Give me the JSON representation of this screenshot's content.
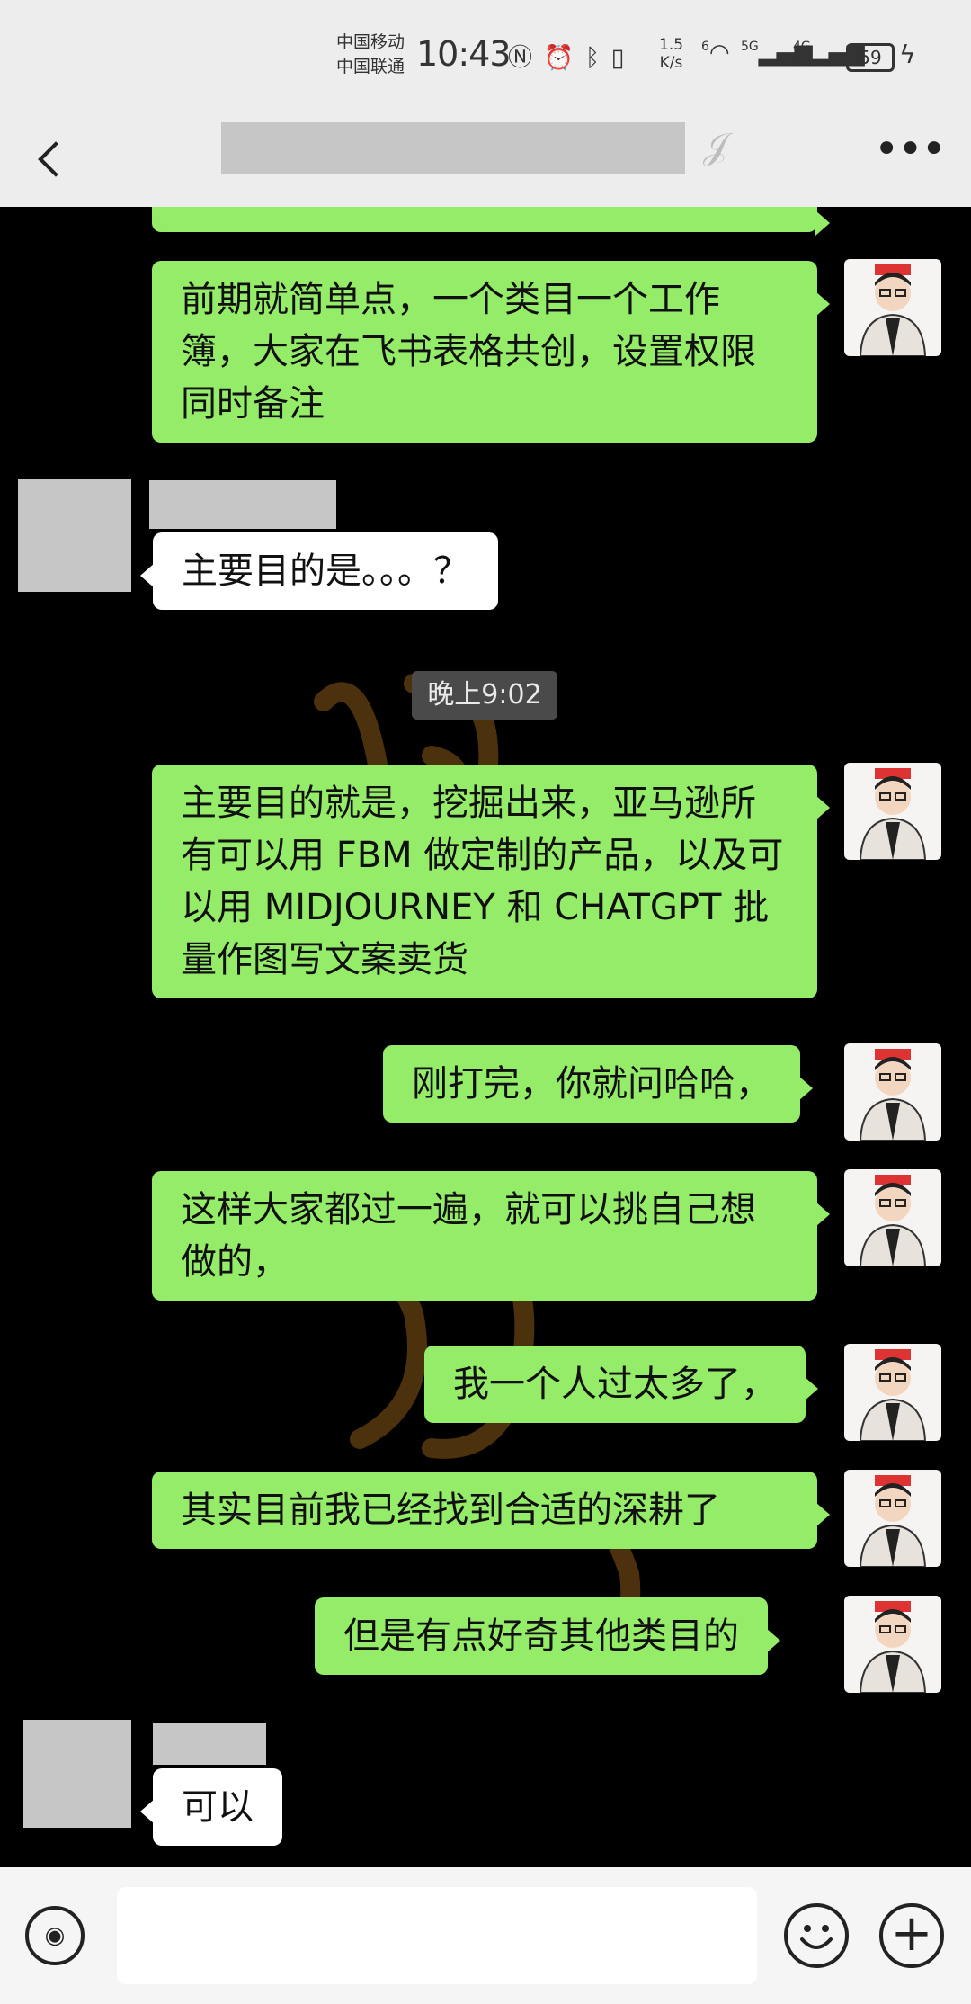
{
  "status": {
    "carrier1": "中国移动",
    "carrier2": "中国联通",
    "time": "10:43",
    "speed_value": "1.5",
    "speed_unit": "K/s",
    "sig_6": "6",
    "sig_5g": "5G",
    "sig_4g": "4G",
    "battery": "59"
  },
  "nav": {
    "more": "•••"
  },
  "messages": [
    {
      "text": "前期就简单点，一个类目一个工作簿，大家在飞书表格共创，设置权限同时备注"
    },
    {
      "text": "主要目的是。。。？"
    },
    {
      "text": "主要目的就是，挖掘出来，亚马逊所有可以用 FBM 做定制的产品，以及可以用 MIDJOURNEY 和 CHATGPT 批量作图写文案卖货"
    },
    {
      "text": "刚打完，你就问哈哈，"
    },
    {
      "text": "这样大家都过一遍，就可以挑自己想做的，"
    },
    {
      "text": "我一个人过太多了，"
    },
    {
      "text": "其实目前我已经找到合适的深耕了"
    },
    {
      "text": "但是有点好奇其他类目的"
    },
    {
      "text": "可以"
    }
  ],
  "timestamp": "晚上9:02",
  "colors": {
    "my_bubble": "#95ec69",
    "other_bubble": "#ffffff",
    "chat_bg": "#000000",
    "bar_bg": "#ededed"
  },
  "icons": [
    "back-arrow-icon",
    "ear-icon",
    "more-icon",
    "voice-icon",
    "emoji-icon",
    "plus-icon"
  ]
}
